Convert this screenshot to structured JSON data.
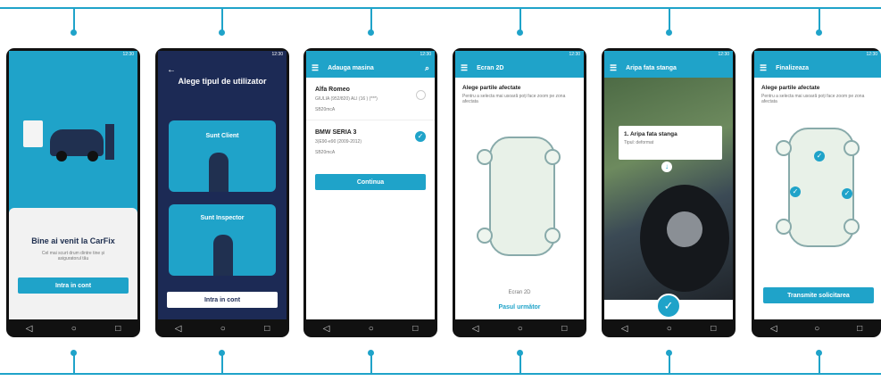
{
  "status_time": "12:30",
  "screen1": {
    "title": "Bine ai venit la CarFix",
    "subtitle": "Cel mai scurt drum dintre tine și asiguratorul tău",
    "button": "Intra in cont"
  },
  "screen2": {
    "back": "←",
    "title": "Alege tipul de utilizator",
    "option1": "Sunt Client",
    "option2": "Sunt Inspector",
    "button": "Intra in cont"
  },
  "screen3": {
    "appbar": "Adauga masina",
    "car1": {
      "name": "Alfa Romeo",
      "detail": "GIULIA (952/820) ALI (16 ) (***)",
      "sub": "SB20mcA"
    },
    "car2": {
      "name": "BMW SERIA 3",
      "detail": "3(E90-e90 (2009-2012)",
      "sub": "SB20mcA"
    },
    "button": "Continua"
  },
  "screen4": {
    "appbar": "Ecran 2D",
    "heading": "Alege partile afectate",
    "desc": "Pentru a selecta mai usoară poți face zoom pe zona afectata",
    "caption": "Ecran 2D",
    "next": "Pasul următor"
  },
  "screen5": {
    "appbar": "Aripa fata stanga",
    "card_title": "1. Aripa fata stanga",
    "card_sub": "Tipul: deformat"
  },
  "screen6": {
    "appbar": "Finalizeaza",
    "heading": "Alege partile afectate",
    "desc": "Pentru a selecta mai usoară poți face zoom pe zona afectata",
    "button": "Transmite solicitarea"
  },
  "icons": {
    "menu": "☰",
    "search": "⌕",
    "back": "◁",
    "home": "○",
    "recent": "□",
    "check": "✓",
    "arrow_down": "↓"
  }
}
